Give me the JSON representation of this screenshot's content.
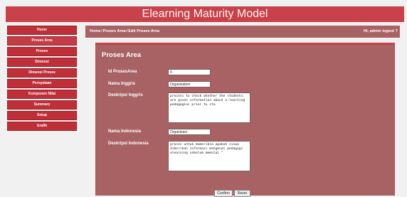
{
  "app_title": "Elearning Maturity Model",
  "sidebar": {
    "items": [
      {
        "label": "Home"
      },
      {
        "label": "Proses Area"
      },
      {
        "label": "Proses"
      },
      {
        "label": "Dimensi"
      },
      {
        "label": "Dimensi Proses"
      },
      {
        "label": "Pernyataan"
      },
      {
        "label": "Komponen Nilai"
      },
      {
        "label": "Summary"
      },
      {
        "label": "Setup"
      },
      {
        "label": "Grafik"
      }
    ]
  },
  "breadcrumb": {
    "home": "Home",
    "sep": "/",
    "proses_area": "Proses Area",
    "edit": "Edit Proses Area"
  },
  "user": {
    "greeting": "Hi, admin",
    "logout": "logout ?"
  },
  "form": {
    "title": "Proses Area",
    "id_label": "Id ProsesArea",
    "id_value": "0",
    "nama_inggris_label": "Nama Inggris",
    "nama_inggris_value": "Organization",
    "deskripsi_inggris_label": "Deskripsi Inggris",
    "deskripsi_inggris_value": "process to check whether the students are given information about e-learning pedagogies prior to sta",
    "nama_indonesia_label": "Nama Indonesia",
    "nama_indonesia_value": "Organisasi",
    "deskripsi_indonesia_label": "Deskripsi Indonesia",
    "deskripsi_indonesia_value": "proses untuk memeriksa apakah siswa diberikan informasi mengenai pedagogi elearning sebelum memulai \"",
    "confirm_label": "Confirm",
    "reset_label": "Reset"
  },
  "colors": {
    "banner": "#c9414a",
    "sidebar_item": "#bf2f38",
    "panel": "#a86264"
  }
}
